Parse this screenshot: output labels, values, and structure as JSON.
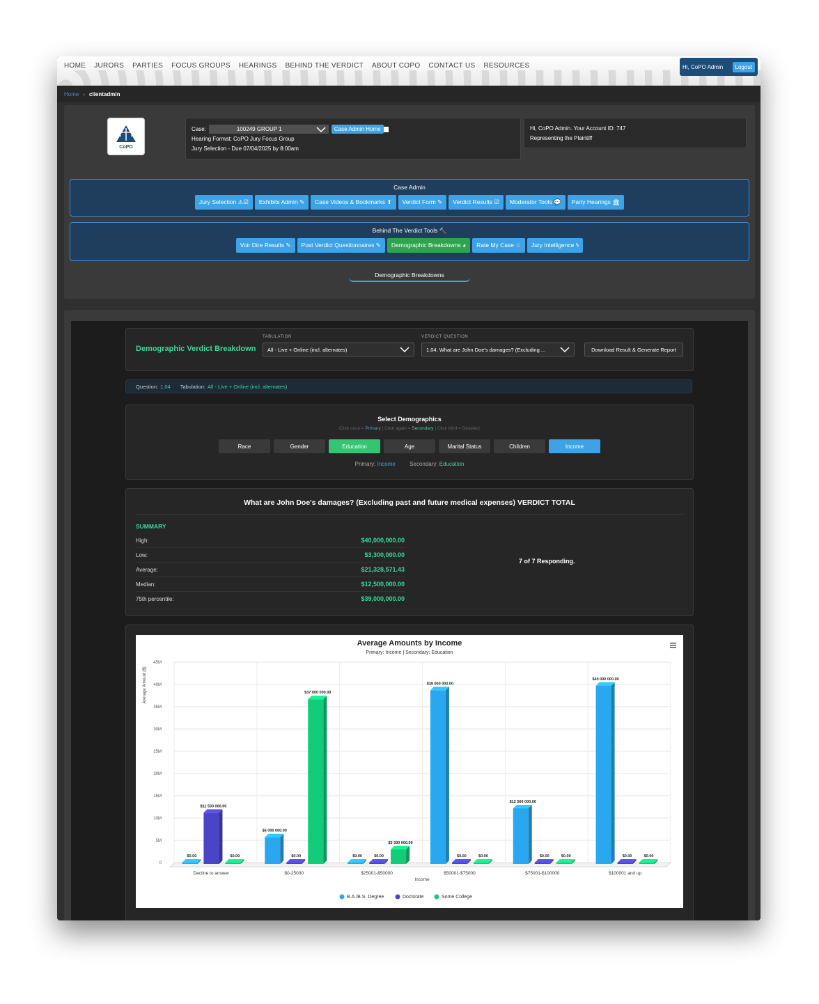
{
  "nav": {
    "links": [
      "HOME",
      "JURORS",
      "PARTIES",
      "FOCUS GROUPS",
      "HEARINGS",
      "BEHIND THE VERDICT",
      "ABOUT COPO",
      "CONTACT US",
      "RESOURCES"
    ],
    "greeting": "Hi, CoPO Admin",
    "logout": "Logout"
  },
  "breadcrumb": {
    "home": "Home",
    "separator": "›",
    "current": "clientadmin"
  },
  "case": {
    "label": "Case:",
    "value": "100249 GROUP 1",
    "admin_home_btn": "Case Admin Home",
    "hearing_format": "Hearing Format: CoPO Jury Focus Group",
    "jury_selection": "Jury Selection - Due 07/04/2025 by 8:00am",
    "logo_text": "CoPO"
  },
  "account": {
    "line1": "Hi, CoPO Admin. Your Account ID: 747",
    "line2": "Representing the Plaintiff"
  },
  "case_admin": {
    "title": "Case Admin",
    "buttons": [
      "Jury Selection ⚠☑",
      "Exhibits Admin ✎",
      "Case Videos & Bookmarks ⬆",
      "Verdict Form ✎",
      "Verdict Results ☑",
      "Moderator Tools 💬",
      "Party Hearings 🏛"
    ]
  },
  "btv_tools": {
    "title": "Behind The Verdict Tools 🔨",
    "buttons": [
      "Voir Dire Results ✎",
      "Post Verdict Questionnaires ✎",
      "Demographic Breakdowns ◕",
      "Rate My Case ☆",
      "Jury Intelligence ϟ"
    ]
  },
  "active_tab": "Demographic Breakdowns",
  "breakdown": {
    "title": "Demographic Verdict Breakdown",
    "tabulation_label": "TABULATION",
    "tabulation_value": "All - Live + Online (incl. alternates)",
    "question_label": "VERDICT QUESTION",
    "question_value": "1.04. What are John Doe's damages? (Excluding ...",
    "download_btn": "Download Result & Generate Report"
  },
  "info_bar": {
    "question_key": "Question:",
    "question_val": "1.04",
    "tabulation_key": "Tabulation:",
    "tabulation_val": "All - Live + Online (incl. alternates)"
  },
  "demographics": {
    "title": "Select Demographics",
    "hint_a": "Click once = ",
    "hint_primary": "Primary",
    "hint_b": " | Click again = ",
    "hint_secondary": "Secondary",
    "hint_c": " | Click third = Deselect",
    "buttons": [
      "Race",
      "Gender",
      "Education",
      "Age",
      "Marital Status",
      "Children",
      "Income"
    ],
    "primary_label": "Primary:",
    "primary_value": "Income",
    "secondary_label": "Secondary:",
    "secondary_value": "Education"
  },
  "summary": {
    "question_title": "What are John Doe's damages? (Excluding past and future medical expenses) VERDICT TOTAL",
    "heading": "SUMMARY",
    "rows": [
      {
        "label": "High:",
        "value": "$40,000,000.00"
      },
      {
        "label": "Low:",
        "value": "$3,300,000.00"
      },
      {
        "label": "Average:",
        "value": "$21,328,571.43"
      },
      {
        "label": "Median:",
        "value": "$12,500,000.00"
      },
      {
        "label": "75th percentile:",
        "value": "$39,000,000.00"
      }
    ],
    "responding": "7 of 7 Responding."
  },
  "chart_data": {
    "type": "bar",
    "title": "Average Amounts by Income",
    "subtitle": "Primary: Income | Secondary: Education",
    "xlabel": "Income",
    "ylabel": "Average Amount ($)",
    "ylim": [
      0,
      45000000
    ],
    "yticks": [
      "0",
      "5M",
      "10M",
      "15M",
      "20M",
      "25M",
      "30M",
      "35M",
      "40M",
      "45M"
    ],
    "categories": [
      "Decline to answer",
      "$0-25000",
      "$25001-$50000",
      "$50001-$75000",
      "$75001-$100000",
      "$100001 and up"
    ],
    "series": [
      {
        "name": "B.A./B.S. Degree",
        "color": "#29a8f0",
        "values": [
          0,
          6000000,
          0,
          39000000,
          12500000,
          40000000
        ],
        "labels": [
          "$0.00",
          "$6 000 000.00",
          "$0.00",
          "$39 000 000.00",
          "$12 500 000.00",
          "$40 000 000.00"
        ]
      },
      {
        "name": "Doctorate",
        "color": "#4a45c6",
        "values": [
          11500000,
          0,
          0,
          0,
          0,
          0
        ],
        "labels": [
          "$11 500 000.00",
          "$0.00",
          "$0.00",
          "$0.00",
          "$0.00",
          "$0.00"
        ]
      },
      {
        "name": "Some College",
        "color": "#12cc7a",
        "values": [
          0,
          37000000,
          3300000,
          0,
          0,
          0
        ],
        "labels": [
          "$0.00",
          "$37 000 000.00",
          "$3 300 000.00",
          "$0.00",
          "$0.00",
          "$0.00"
        ]
      }
    ],
    "legend_position": "bottom",
    "grid": true
  },
  "menu_icon": "hamburger-menu-icon"
}
